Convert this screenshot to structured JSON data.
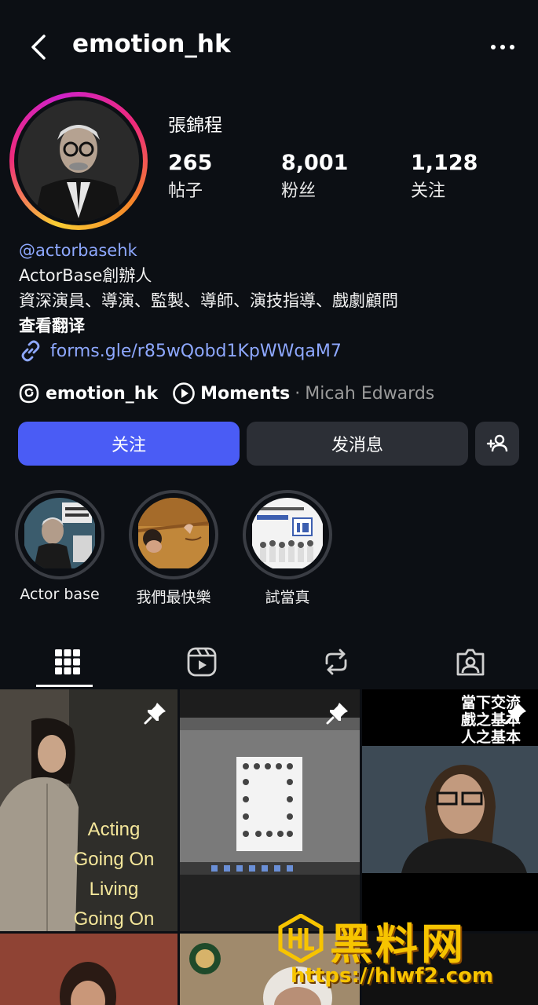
{
  "header": {
    "username": "emotion_hk"
  },
  "profile": {
    "full_name": "張錦程",
    "stats": [
      {
        "value": "265",
        "label": "帖子"
      },
      {
        "value": "8,001",
        "label": "粉丝"
      },
      {
        "value": "1,128",
        "label": "关注"
      }
    ],
    "bio": {
      "handle": "@actorbasehk",
      "line1": "ActorBase創辦人",
      "line2": "資深演員、導演、監製、導師、演技指導、戲劇顧問",
      "translate": "查看翻译",
      "link": "forms.gle/r85wQobd1KpWWqaM7"
    },
    "threads": {
      "name": "emotion_hk",
      "moments": "Moments",
      "separator": "·",
      "author": "Micah Edwards"
    }
  },
  "actions": {
    "follow": "关注",
    "message": "发消息"
  },
  "highlights": [
    {
      "label": "Actor base"
    },
    {
      "label": "我們最快樂"
    },
    {
      "label": "試當真"
    }
  ],
  "grid": {
    "post1_text": [
      "Acting",
      "Going On",
      "Living",
      "Going On"
    ],
    "post3_text": [
      "當下交流",
      "戲之基本",
      "人之基本"
    ]
  },
  "watermark": {
    "brand": "黑料网",
    "url": "https://hlwf2.com"
  },
  "colors": {
    "accent": "#4a5cf5",
    "link": "#8ea8ff",
    "background": "#0c0f14",
    "watermark": "#f7c400"
  },
  "icons": [
    "back-arrow-icon",
    "more-icon",
    "link-icon",
    "threads-icon",
    "play-circle-icon",
    "add-person-icon",
    "grid-icon",
    "reels-icon",
    "repost-icon",
    "tagged-icon",
    "pin-icon"
  ]
}
